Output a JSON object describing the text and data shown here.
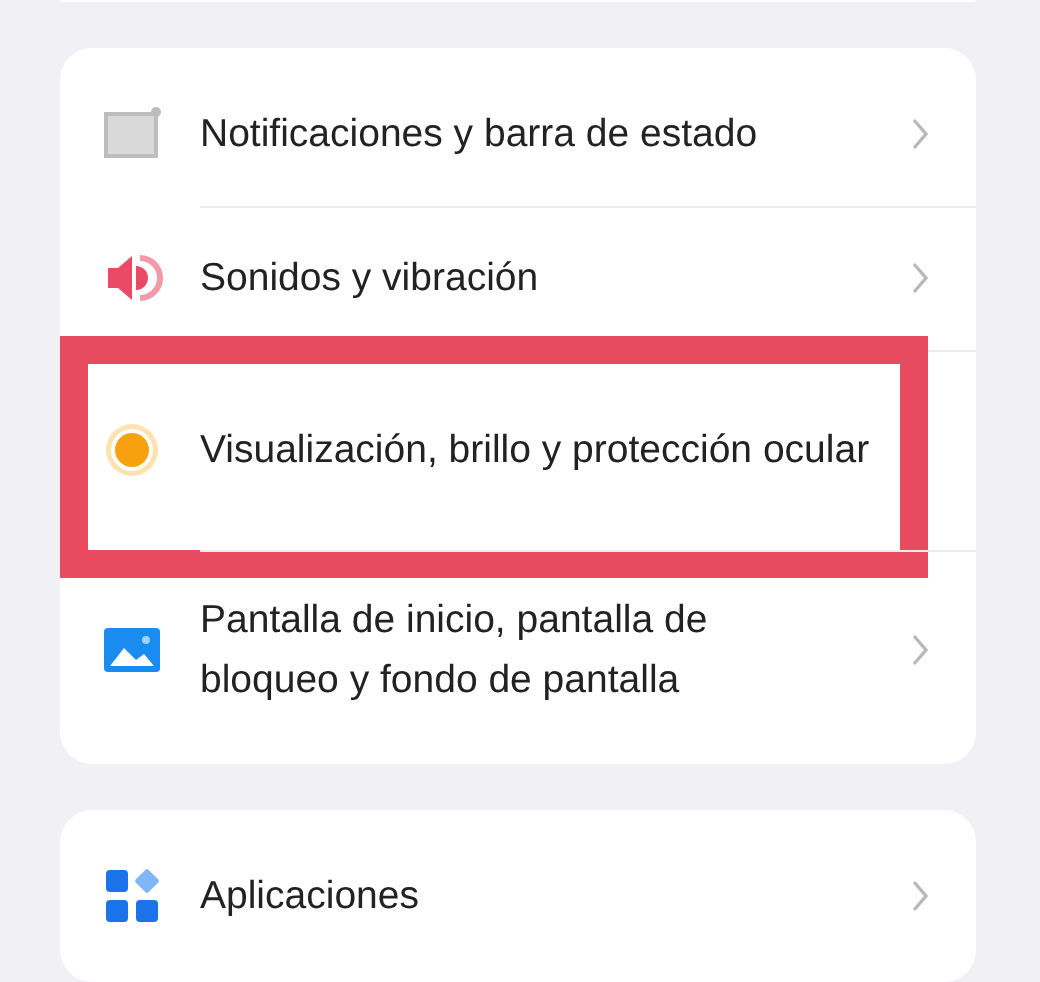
{
  "groups": [
    {
      "kind": "stub"
    },
    {
      "items": [
        {
          "kind": "notifications",
          "label": "Notificaciones y barra de estado",
          "highlighted": false
        },
        {
          "kind": "sound",
          "label": "Sonidos y vibración",
          "highlighted": false
        },
        {
          "kind": "display",
          "label": "Visualización, brillo y protección ocular",
          "highlighted": true
        },
        {
          "kind": "wallpaper",
          "label": "Pantalla de inicio, pantalla de bloqueo y fondo de pantalla",
          "highlighted": false
        }
      ]
    },
    {
      "items": [
        {
          "kind": "apps",
          "label": "Aplicaciones",
          "highlighted": false
        }
      ]
    }
  ]
}
